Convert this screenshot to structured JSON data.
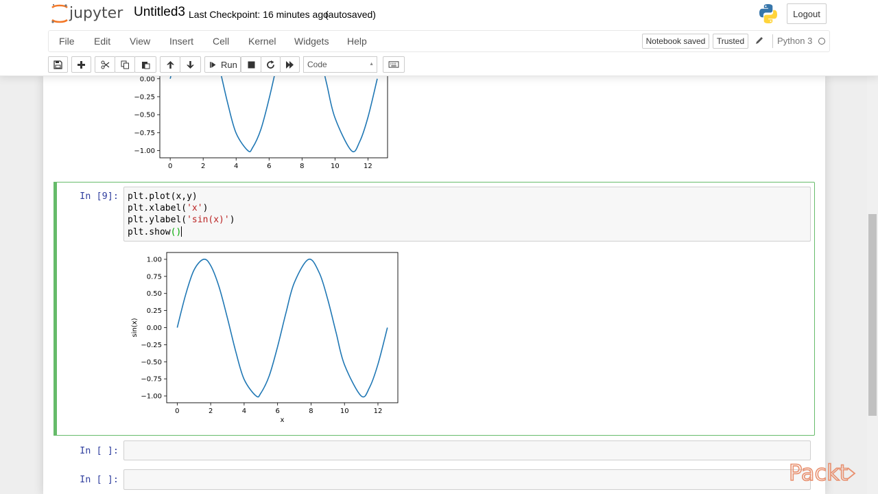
{
  "header": {
    "logo_text": "jupyter",
    "notebook_name": "Untitled3",
    "checkpoint_text": "Last Checkpoint: 16 minutes ago",
    "autosave_text": "(autosaved)",
    "logout_label": "Logout"
  },
  "menu": {
    "items": [
      "File",
      "Edit",
      "View",
      "Insert",
      "Cell",
      "Kernel",
      "Widgets",
      "Help"
    ],
    "notebook_saved": "Notebook saved",
    "trusted": "Trusted",
    "kernel_name": "Python 3"
  },
  "toolbar": {
    "run_label": "Run",
    "cell_type": "Code",
    "icons": [
      "save-icon",
      "plus-icon",
      "cut-icon",
      "copy-icon",
      "paste-icon",
      "arrow-up-icon",
      "arrow-down-icon",
      "run-icon",
      "stop-icon",
      "restart-icon",
      "fast-forward-icon",
      "keyboard-icon"
    ]
  },
  "cells": {
    "active": {
      "prompt": "In [9]:",
      "lines": [
        "plt.plot(x,y)",
        "plt.xlabel(",
        "'x'",
        ")",
        "plt.ylabel(",
        "'sin(x)'",
        ")",
        "plt.show",
        "()"
      ]
    },
    "empty1": {
      "prompt": "In [ ]:"
    },
    "empty2": {
      "prompt": "In [ ]:"
    }
  },
  "chart_data": [
    {
      "type": "line",
      "title": "",
      "xlabel": "",
      "ylabel": "",
      "xlim": [
        -0.63,
        13.19
      ],
      "ylim": [
        -1.1,
        1.1
      ],
      "xticks": [
        0,
        2,
        4,
        6,
        8,
        10,
        12
      ],
      "yticks": [
        "0.00",
        "−0.25",
        "−0.50",
        "−0.75",
        "−1.00"
      ],
      "series": [
        {
          "x": [
            0,
            0.5,
            1,
            1.5708,
            2,
            2.5,
            3,
            3.5,
            4,
            4.7124,
            5,
            5.5,
            6,
            6.5,
            7,
            7.854,
            8.5,
            9,
            9.5,
            10,
            10.9956,
            11.5,
            12,
            12.566
          ],
          "values": [
            0,
            0.479,
            0.841,
            1.0,
            0.909,
            0.598,
            0.141,
            -0.351,
            -0.757,
            -1.0,
            -0.959,
            -0.706,
            -0.279,
            0.215,
            0.657,
            1.0,
            0.798,
            0.412,
            -0.075,
            -0.544,
            -1.0,
            -0.875,
            -0.537,
            0.0
          ]
        }
      ],
      "color": "#1f77b4"
    },
    {
      "type": "line",
      "title": "",
      "xlabel": "x",
      "ylabel": "sin(x)",
      "xlim": [
        -0.63,
        13.19
      ],
      "ylim": [
        -1.1,
        1.1
      ],
      "xticks": [
        0,
        2,
        4,
        6,
        8,
        10,
        12
      ],
      "yticks": [
        "1.00",
        "0.75",
        "0.50",
        "0.25",
        "0.00",
        "−0.25",
        "−0.50",
        "−0.75",
        "−1.00"
      ],
      "series": [
        {
          "x": [
            0,
            0.5,
            1,
            1.5708,
            2,
            2.5,
            3,
            3.5,
            4,
            4.7124,
            5,
            5.5,
            6,
            6.5,
            7,
            7.854,
            8.5,
            9,
            9.5,
            10,
            10.9956,
            11.5,
            12,
            12.566
          ],
          "values": [
            0,
            0.479,
            0.841,
            1.0,
            0.909,
            0.598,
            0.141,
            -0.351,
            -0.757,
            -1.0,
            -0.959,
            -0.706,
            -0.279,
            0.215,
            0.657,
            1.0,
            0.798,
            0.412,
            -0.075,
            -0.544,
            -1.0,
            -0.875,
            -0.537,
            0.0
          ]
        }
      ],
      "color": "#1f77b4"
    }
  ],
  "watermark": {
    "brand": "Packt>"
  }
}
